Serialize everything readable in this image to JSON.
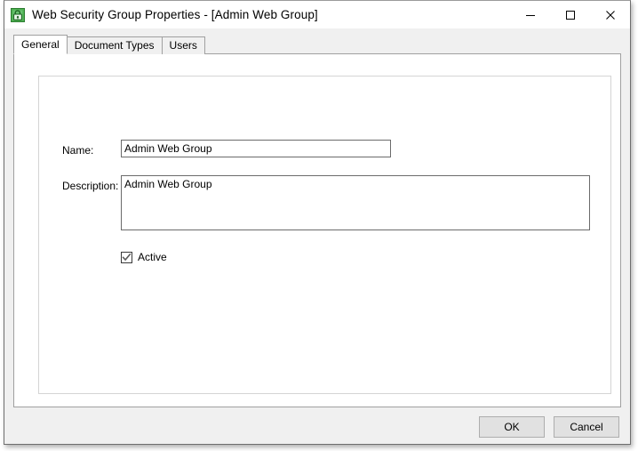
{
  "window": {
    "title": "Web Security Group Properties - [Admin Web Group]",
    "icon": "web-security-group-icon",
    "controls": {
      "minimize": "Minimize",
      "maximize": "Maximize",
      "close": "Close"
    },
    "colors": {
      "titlebar_bg": "#ffffff",
      "window_bg": "#f0f0f0",
      "content_bg": "#ffffff",
      "border": "#6e6e6e",
      "icon_green": "#3aa33a",
      "button_face": "#e1e1e1",
      "button_border": "#adadad"
    }
  },
  "tabs": [
    {
      "label": "General",
      "selected": true
    },
    {
      "label": "Document Types",
      "selected": false
    },
    {
      "label": "Users",
      "selected": false
    }
  ],
  "form": {
    "name": {
      "label": "Name:",
      "value": "Admin Web Group",
      "placeholder": ""
    },
    "description": {
      "label": "Description:",
      "value": "Admin Web Group",
      "placeholder": ""
    },
    "active": {
      "label": "Active",
      "checked": true
    }
  },
  "footer": {
    "ok_label": "OK",
    "cancel_label": "Cancel"
  }
}
